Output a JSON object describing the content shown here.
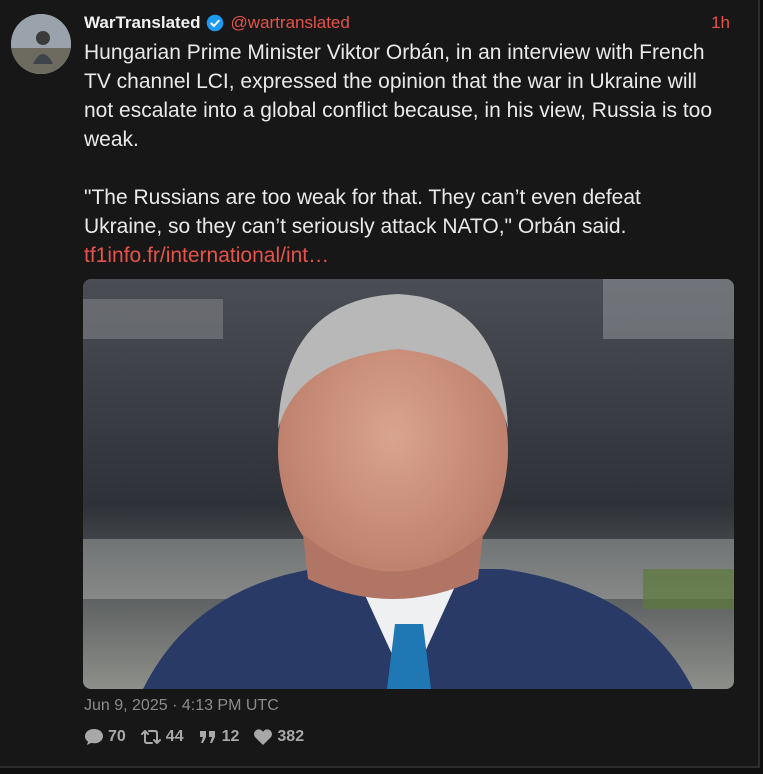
{
  "post": {
    "author": {
      "display_name": "WarTranslated",
      "handle": "@wartranslated",
      "verified": true
    },
    "time_ago": "1h",
    "paragraphs": [
      "Hungarian Prime Minister Viktor Orbán, in an interview with French TV channel LCI, expressed the opinion that the war in Ukraine will not escalate into a global conflict because, in his view, Russia is too weak.",
      "\"The Russians are too weak for that. They can’t even defeat Ukraine, so they can’t seriously attack NATO,\" Orbán said."
    ],
    "link_text": "tf1info.fr/international/int…",
    "timestamp": "Jun 9, 2025 · 4:13 PM UTC",
    "stats": {
      "replies": "70",
      "reposts": "44",
      "quotes": "12",
      "likes": "382"
    }
  },
  "colors": {
    "accent": "#e5534b",
    "background": "#171717",
    "verified": "#1d9bf0"
  },
  "icons": {
    "verified": "verified-badge-icon",
    "replies": "comment-icon",
    "reposts": "repost-icon",
    "quotes": "quote-icon",
    "likes": "heart-icon"
  }
}
